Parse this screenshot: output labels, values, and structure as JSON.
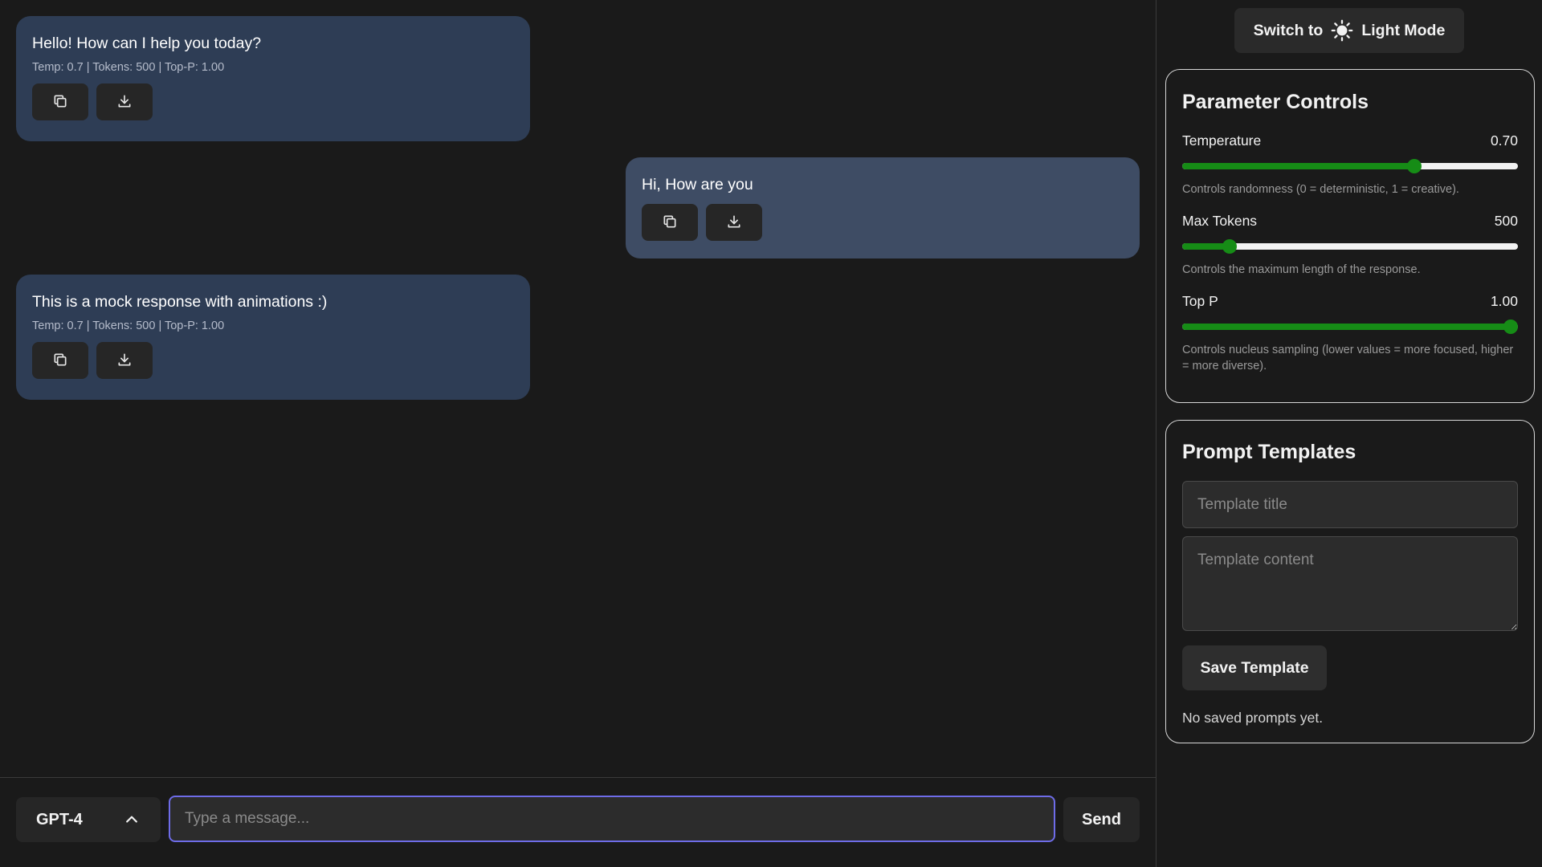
{
  "messages": [
    {
      "role": "assistant",
      "text": "Hello! How can I help you today?",
      "meta": "Temp: 0.7 | Tokens: 500 | Top-P: 1.00"
    },
    {
      "role": "user",
      "text": "Hi, How are you",
      "meta": ""
    },
    {
      "role": "assistant",
      "text": "This is a mock response with animations :)",
      "meta": "Temp: 0.7 | Tokens: 500 | Top-P: 1.00"
    }
  ],
  "message_actions": {
    "copy_icon": "copy-icon",
    "download_icon": "download-icon"
  },
  "input_bar": {
    "model_label": "GPT-4",
    "model_icon": "chevron-up-icon",
    "placeholder": "Type a message...",
    "value": "",
    "send_label": "Send"
  },
  "sidebar": {
    "theme_toggle": {
      "prefix": "Switch to",
      "icon": "sun-icon",
      "label": "Light Mode"
    },
    "parameter_controls": {
      "title": "Parameter Controls",
      "params": [
        {
          "label": "Temperature",
          "display": "0.70",
          "value": 0.7,
          "min": 0,
          "max": 1,
          "description": "Controls randomness (0 = deterministic, 1 = creative)."
        },
        {
          "label": "Max Tokens",
          "display": "500",
          "value": 500,
          "min": 0,
          "max": 4000,
          "description": "Controls the maximum length of the response."
        },
        {
          "label": "Top P",
          "display": "1.00",
          "value": 1.0,
          "min": 0,
          "max": 1,
          "description": "Controls nucleus sampling (lower values = more focused, higher = more diverse)."
        }
      ]
    },
    "prompt_templates": {
      "title": "Prompt Templates",
      "title_placeholder": "Template title",
      "content_placeholder": "Template content",
      "save_label": "Save Template",
      "empty_text": "No saved prompts yet."
    }
  },
  "colors": {
    "background": "#1a1a1a",
    "assistant_bubble": "#2e3d55",
    "user_bubble": "#3e4c64",
    "slider_accent": "#168c16",
    "input_focus": "#6e6ce8"
  }
}
